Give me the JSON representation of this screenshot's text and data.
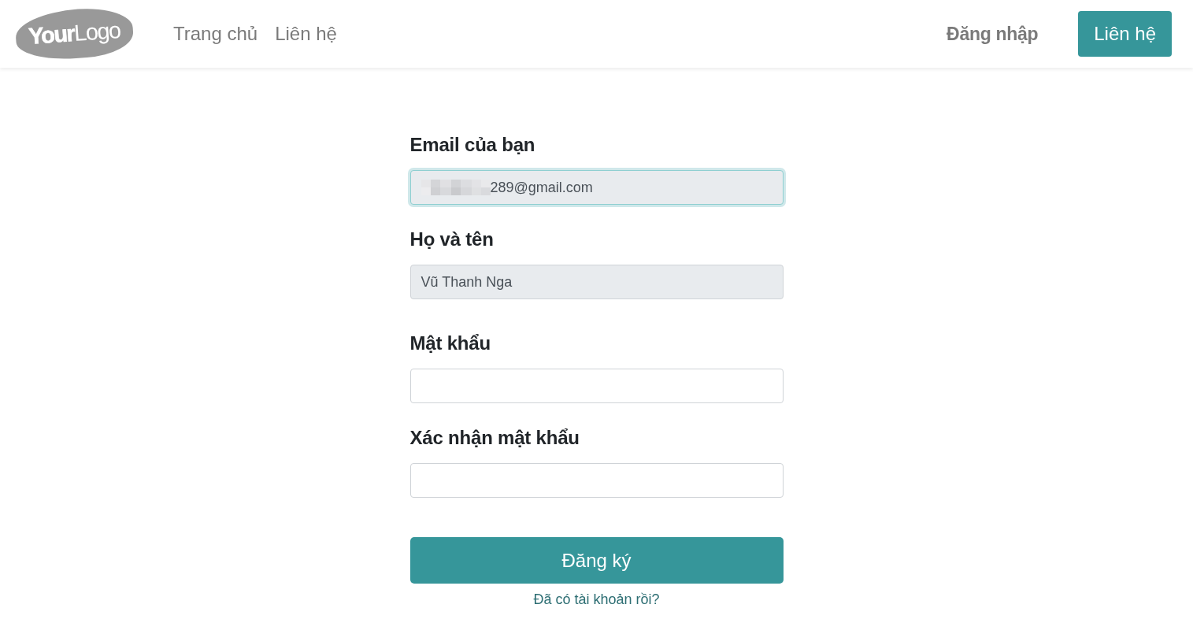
{
  "header": {
    "logo": "**Your**Logo",
    "nav_links": [
      "Trang chủ",
      "Liên hệ"
    ],
    "login_link": "Đăng nhập",
    "contact_button": "Liên hệ"
  },
  "form": {
    "fields": [
      {
        "label": "Email của bạn",
        "value": "289@gmail.com",
        "redacted": true,
        "focused": true,
        "readonly": true
      },
      {
        "label": "Họ và tên",
        "value": "Vũ Thanh Nga",
        "redacted": false,
        "focused": false,
        "readonly": true
      },
      {
        "label": "Mật khẩu",
        "redacted": false,
        "focused": false,
        "readonly": false
      },
      {
        "label": "Xác nhận mật khẩu",
        "redacted": false,
        "focused": false,
        "readonly": false
      }
    ],
    "submit_button": "Đăng ký",
    "login_prompt": "Đã có tài khoản rồi?"
  }
}
